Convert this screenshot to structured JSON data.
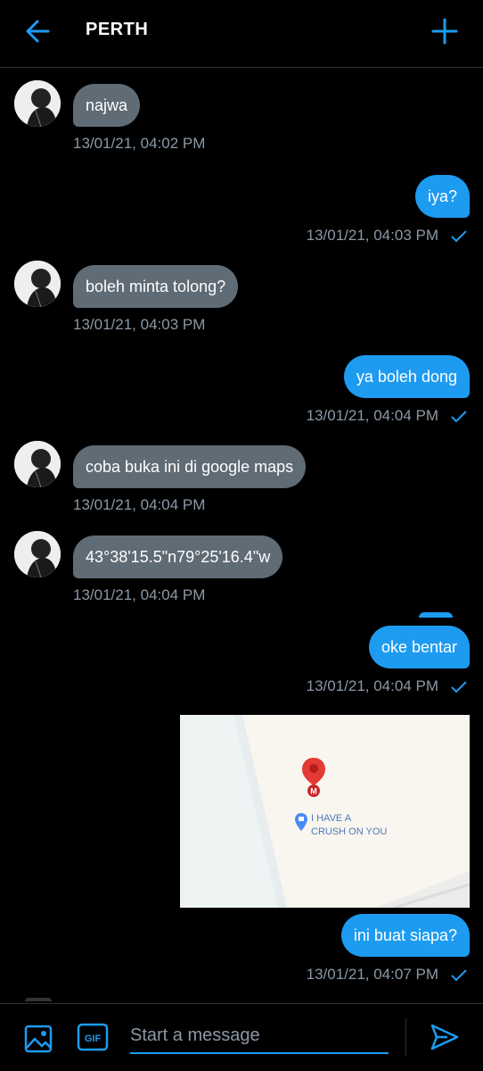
{
  "header": {
    "title": "PERTH",
    "back_icon": "arrow-left-icon",
    "add_icon": "plus-icon"
  },
  "colors": {
    "accent": "#1d9bf0",
    "incoming_bubble": "#5f6b75",
    "timestamp": "#8b98a5",
    "background": "#000000"
  },
  "messages": [
    {
      "direction": "in",
      "text": "najwa",
      "time": "13/01/21, 04:02 PM"
    },
    {
      "direction": "out",
      "text": "iya?",
      "time": "13/01/21, 04:03 PM"
    },
    {
      "direction": "in",
      "text": "boleh minta tolong?",
      "time": "13/01/21, 04:03 PM"
    },
    {
      "direction": "out",
      "text": "ya boleh dong",
      "time": "13/01/21, 04:04 PM"
    },
    {
      "direction": "in",
      "text": "coba buka ini di google maps",
      "time": "13/01/21, 04:04 PM"
    },
    {
      "direction": "in",
      "text": "43°38'15.5\"n79°25'16.4\"w",
      "time": "13/01/21, 04:04 PM"
    },
    {
      "direction": "out",
      "text": "oke bentar",
      "time": "13/01/21, 04:04 PM"
    },
    {
      "direction": "out",
      "text": "ini buat siapa?",
      "time": "13/01/21, 04:07 PM"
    }
  ],
  "map": {
    "pin_letter": "M",
    "place_label_line1": "I HAVE A",
    "place_label_line2": "CRUSH ON YOU"
  },
  "composer": {
    "placeholder": "Start a message",
    "gif_label": "GIF",
    "image_icon": "image-icon",
    "send_icon": "send-icon"
  }
}
